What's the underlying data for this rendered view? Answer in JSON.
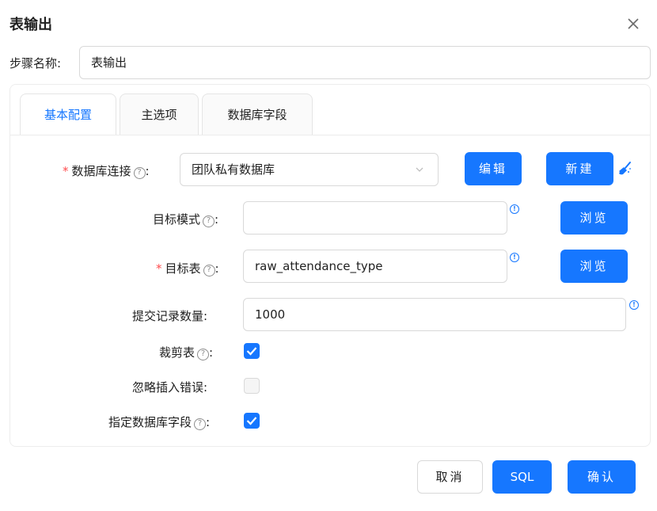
{
  "dialog": {
    "title": "表输出",
    "close_icon": "close-icon"
  },
  "step": {
    "label": "步骤名称:",
    "value": "表输出"
  },
  "tabs": [
    {
      "label": "基本配置",
      "active": true
    },
    {
      "label": "主选项",
      "active": false
    },
    {
      "label": "数据库字段",
      "active": false
    }
  ],
  "form": {
    "db_connection": {
      "label": "数据库连接",
      "required": true,
      "help_icon": "question-circle-icon",
      "value": "团队私有数据库",
      "edit_button": "编辑",
      "new_button": "新建",
      "clean_icon": "broom-icon"
    },
    "target_schema": {
      "label": "目标模式",
      "help_icon": "question-circle-icon",
      "value": "",
      "info_icon": "info-icon",
      "browse_button": "浏览"
    },
    "target_table": {
      "label": "目标表",
      "required": true,
      "help_icon": "question-circle-icon",
      "value": "raw_attendance_type",
      "info_icon": "info-icon",
      "browse_button": "浏览"
    },
    "commit_size": {
      "label": "提交记录数量:",
      "value": "1000",
      "info_icon": "info-icon"
    },
    "truncate_table": {
      "label": "裁剪表",
      "help_icon": "question-circle-icon",
      "checked": true
    },
    "ignore_errors": {
      "label": "忽略插入错误:",
      "checked": false
    },
    "specify_fields": {
      "label": "指定数据库字段",
      "help_icon": "question-circle-icon",
      "checked": true
    }
  },
  "footer": {
    "cancel": "取消",
    "sql": "SQL",
    "confirm": "确认"
  },
  "colors": {
    "primary": "#1677ff",
    "required": "#ff4d4f",
    "border": "#d9d9d9"
  }
}
